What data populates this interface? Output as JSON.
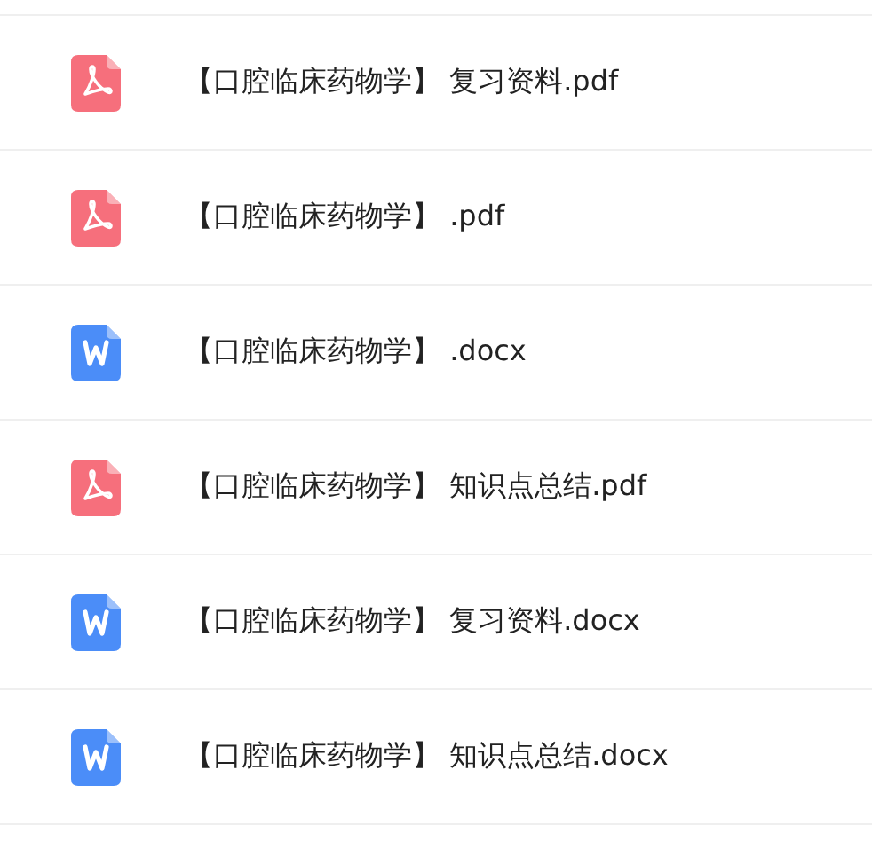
{
  "files": [
    {
      "kind": "pdf",
      "name": "【口腔临床药物学】 复习资料.pdf"
    },
    {
      "kind": "pdf",
      "name": "【口腔临床药物学】 .pdf"
    },
    {
      "kind": "word",
      "name": "【口腔临床药物学】 .docx"
    },
    {
      "kind": "pdf",
      "name": "【口腔临床药物学】 知识点总结.pdf"
    },
    {
      "kind": "word",
      "name": "【口腔临床药物学】 复习资料.docx"
    },
    {
      "kind": "word",
      "name": "【口腔临床药物学】 知识点总结.docx"
    }
  ]
}
